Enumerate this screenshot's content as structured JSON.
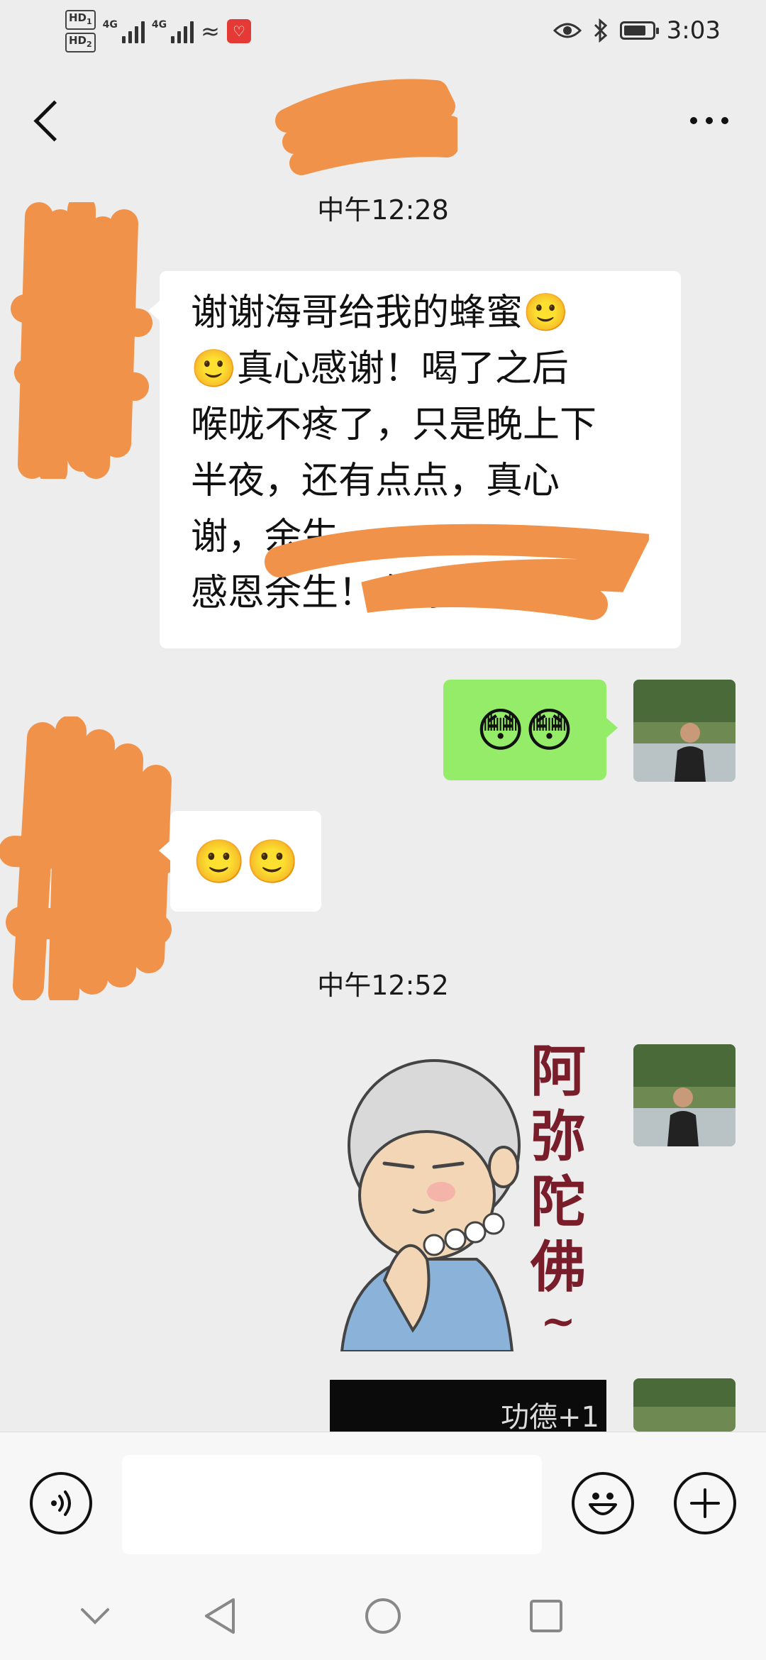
{
  "status_bar": {
    "hd1": "HD",
    "hd2": "HD",
    "net1": "4G",
    "net2": "4G",
    "time": "3:03",
    "battery_level": 0.8,
    "icons": [
      "eye-icon",
      "bluetooth-icon",
      "battery-icon"
    ]
  },
  "header": {
    "title": "",
    "back_icon": "chevron-left-icon",
    "more_icon": "more-dots-icon"
  },
  "messages": {
    "time1": "中午12:28",
    "msg1_text": "谢谢海哥给我的蜂蜜🙂\n🙂真心感谢！喝了之后\n喉咙不疼了，只是晚上下\n半夜，还有点点，真心\n谢，余生                    ，\n感恩余生！有你",
    "msg2_emoji": "😳😳",
    "msg3_emoji": "🙂🙂",
    "time2": "中午12:52",
    "sticker_text": [
      "阿",
      "弥",
      "陀",
      "佛"
    ],
    "sticker_tilde": "~",
    "video_caption": "功德+1"
  },
  "input": {
    "placeholder": "",
    "voice_icon": "voice-icon",
    "emoji_icon": "smiley-icon",
    "plus_icon": "plus-icon"
  },
  "colors": {
    "background": "#ededed",
    "sent_bubble": "#95ec69",
    "received_bubble": "#ffffff",
    "redaction": "#f0924a"
  }
}
